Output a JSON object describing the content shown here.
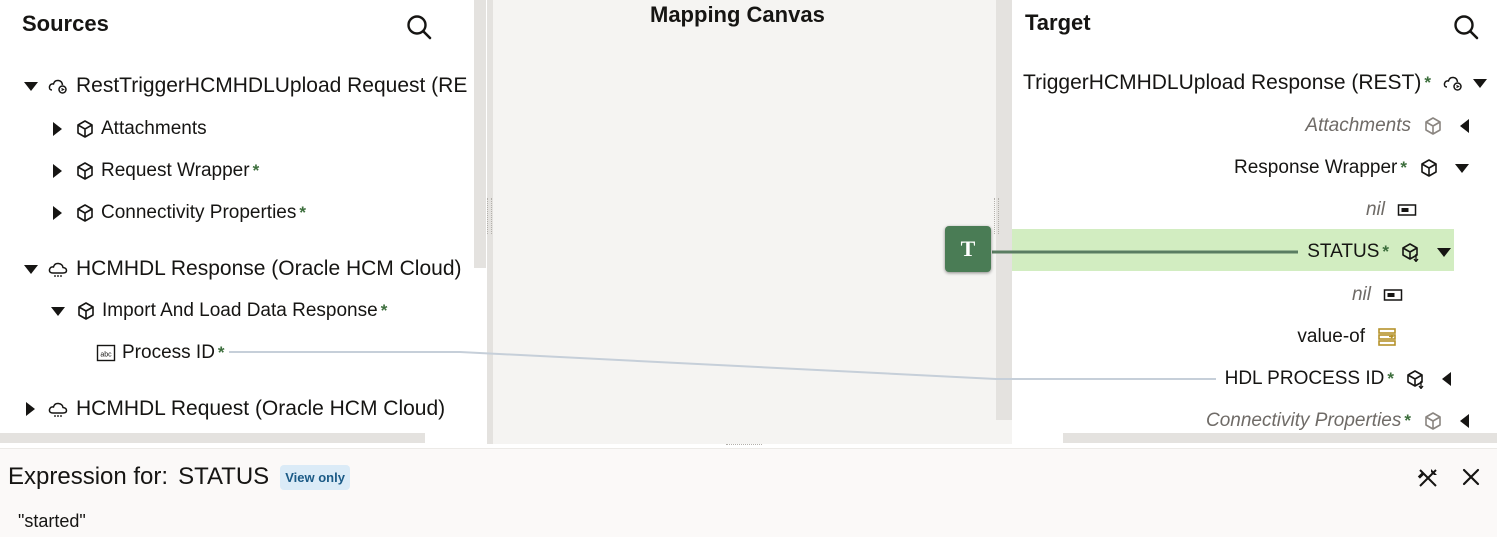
{
  "sources": {
    "title": "Sources",
    "items": [
      {
        "label": "RestTriggerHCMHDLUpload Request (RE",
        "required": false
      },
      {
        "label": "Attachments",
        "required": false
      },
      {
        "label": "Request Wrapper",
        "required": true
      },
      {
        "label": "Connectivity Properties",
        "required": true
      },
      {
        "label": "HCMHDL Response (Oracle HCM Cloud)",
        "required": false
      },
      {
        "label": "Import And Load Data Response",
        "required": true
      },
      {
        "label": "Process ID",
        "required": true
      },
      {
        "label": "HCMHDL Request (Oracle HCM Cloud)",
        "required": false
      }
    ]
  },
  "canvas": {
    "title": "Mapping Canvas",
    "function_label": "T"
  },
  "target": {
    "title": "Target",
    "items": [
      {
        "label": "TriggerHCMHDLUpload Response (REST)",
        "required": true
      },
      {
        "label": "Attachments",
        "required": false
      },
      {
        "label": "Response Wrapper",
        "required": true
      },
      {
        "label": "nil",
        "required": false
      },
      {
        "label": "STATUS",
        "required": true
      },
      {
        "label": "nil",
        "required": false
      },
      {
        "label": "value-of",
        "required": false
      },
      {
        "label": "HDL PROCESS ID",
        "required": true
      },
      {
        "label": "Connectivity Properties",
        "required": true
      }
    ]
  },
  "required_marker": "*",
  "expression": {
    "prefix": "Expression for:",
    "field": "STATUS",
    "badge": "View only",
    "value": "\"started\""
  },
  "colors": {
    "required_star": "#3c6e3c",
    "function_node": "#4a7c55",
    "highlight_row": "#d2edc1",
    "mapping_line": "#c6cfd9",
    "value_of_icon": "#b5932c",
    "badge_bg": "#dbebf7",
    "badge_text": "#1b5a86"
  }
}
